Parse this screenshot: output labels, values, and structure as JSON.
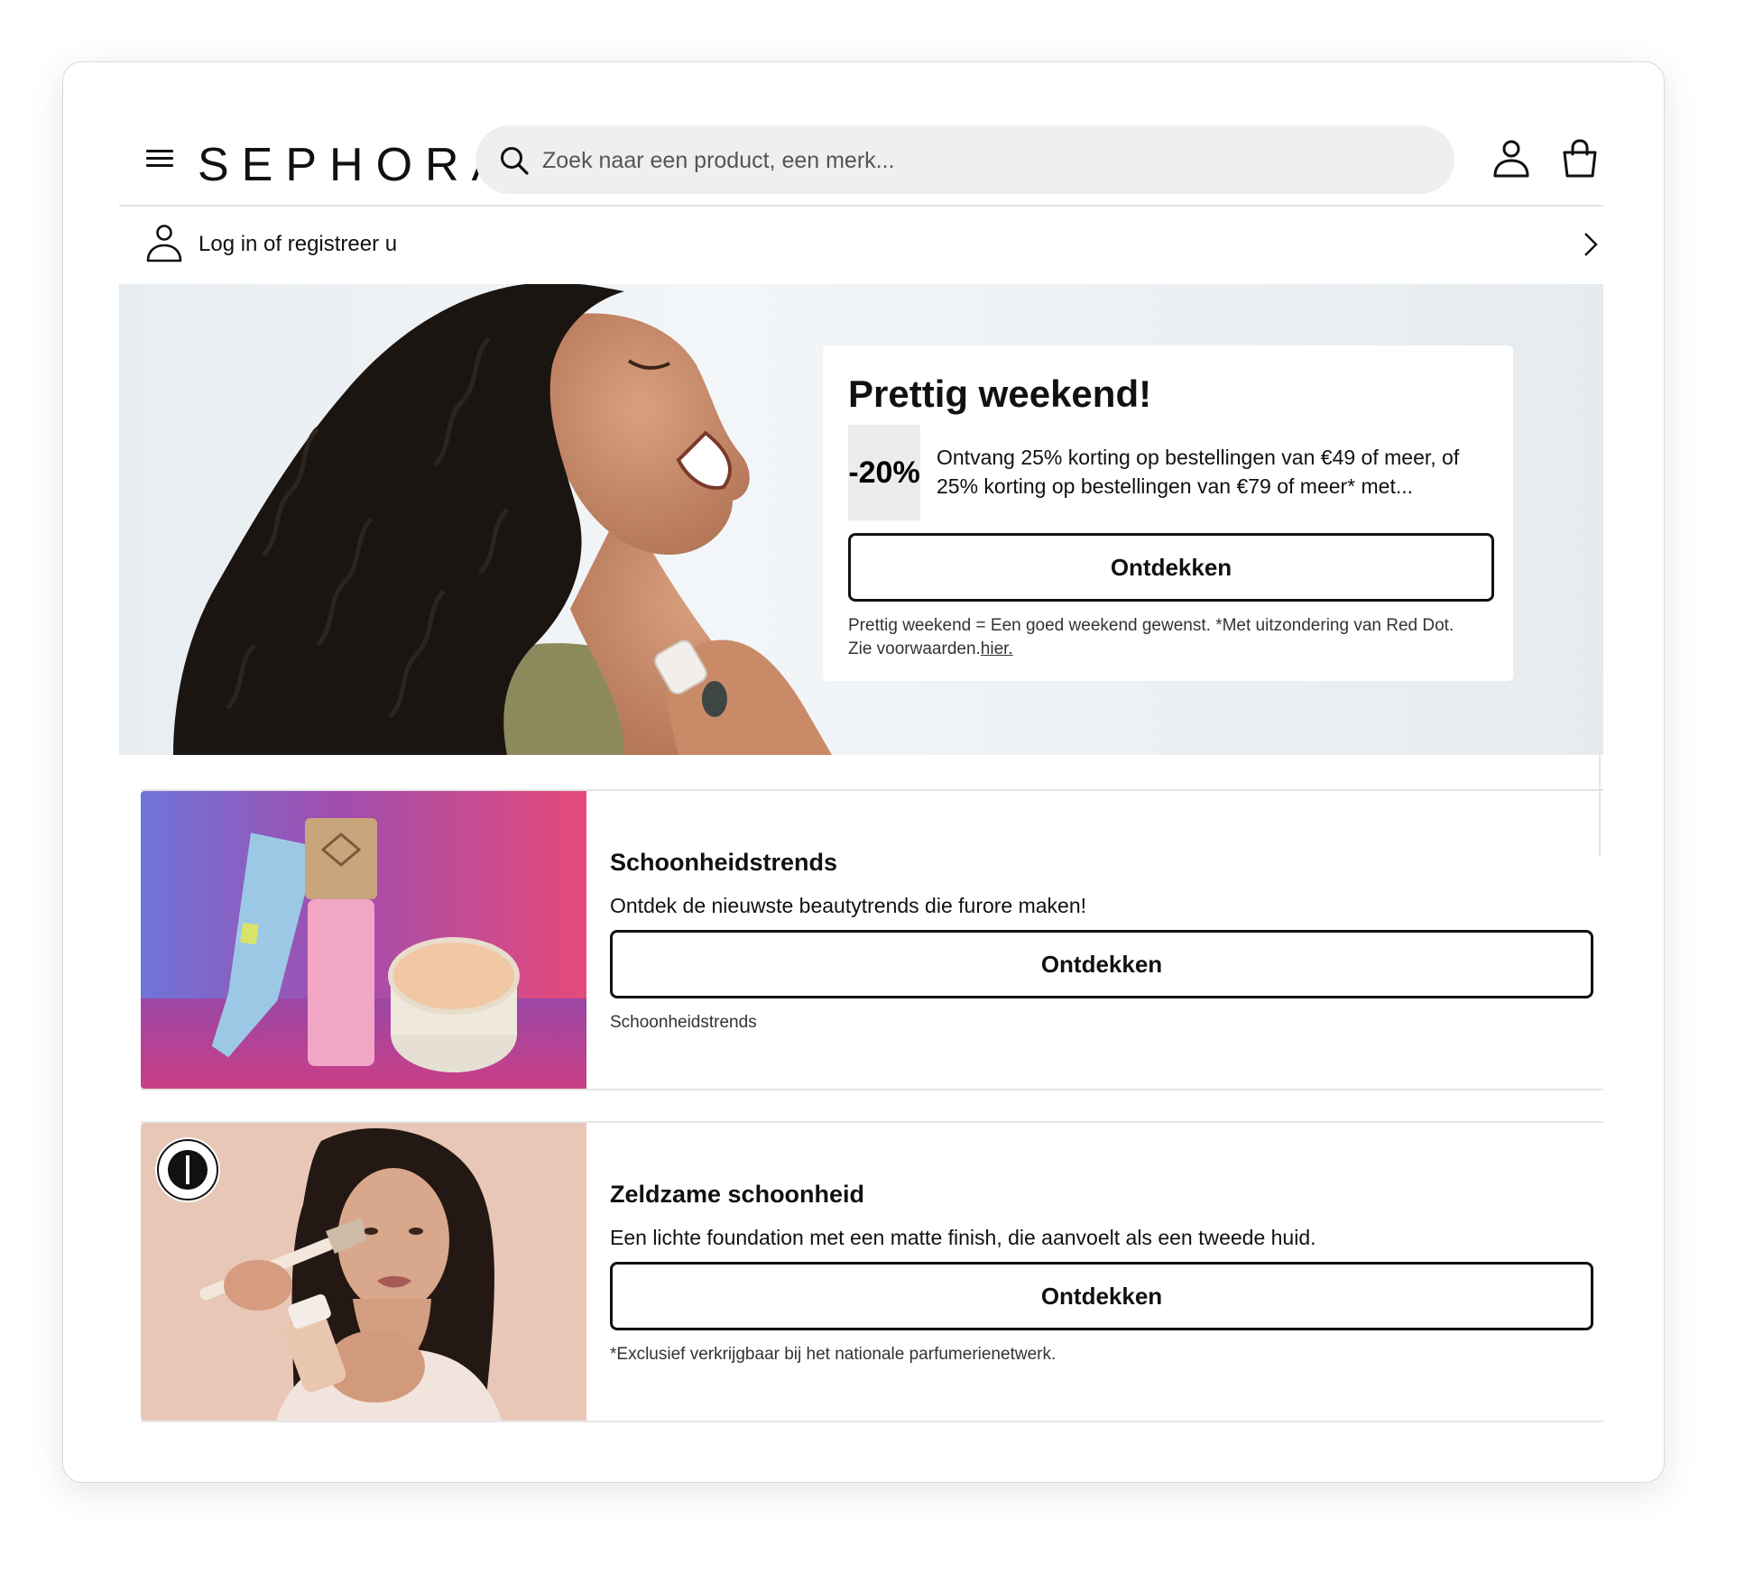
{
  "header": {
    "logo": "SEPHORA",
    "search_placeholder": "Zoek naar een product, een merk..."
  },
  "login": {
    "label": "Log in of registreer u"
  },
  "promo": {
    "title": "Prettig weekend!",
    "badge": "-20%",
    "text": "Ontvang 25% korting op bestellingen van €49 of meer, of 25% korting op bestellingen van €79 of meer* met...",
    "button": "Ontdekken",
    "footnote": "Prettig weekend = Een goed weekend gewenst. *Met uitzondering van Red Dot. Zie voorwaarden.",
    "footnote_link": "hier."
  },
  "cards": [
    {
      "title": "Schoonheidstrends",
      "desc": "Ontdek de nieuwste beautytrends die furore maken!",
      "button": "Ontdekken",
      "footnote": "Schoonheidstrends"
    },
    {
      "title": "Zeldzame schoonheid",
      "desc": "Een lichte foundation met een matte finish, die aanvoelt als een tweede huid.",
      "button": "Ontdekken",
      "footnote": "*Exclusief verkrijgbaar bij het nationale parfumerienetwerk."
    }
  ],
  "colors": {
    "accent": "#000000",
    "search_bg": "#efefef",
    "divider": "#e6e6e6"
  }
}
